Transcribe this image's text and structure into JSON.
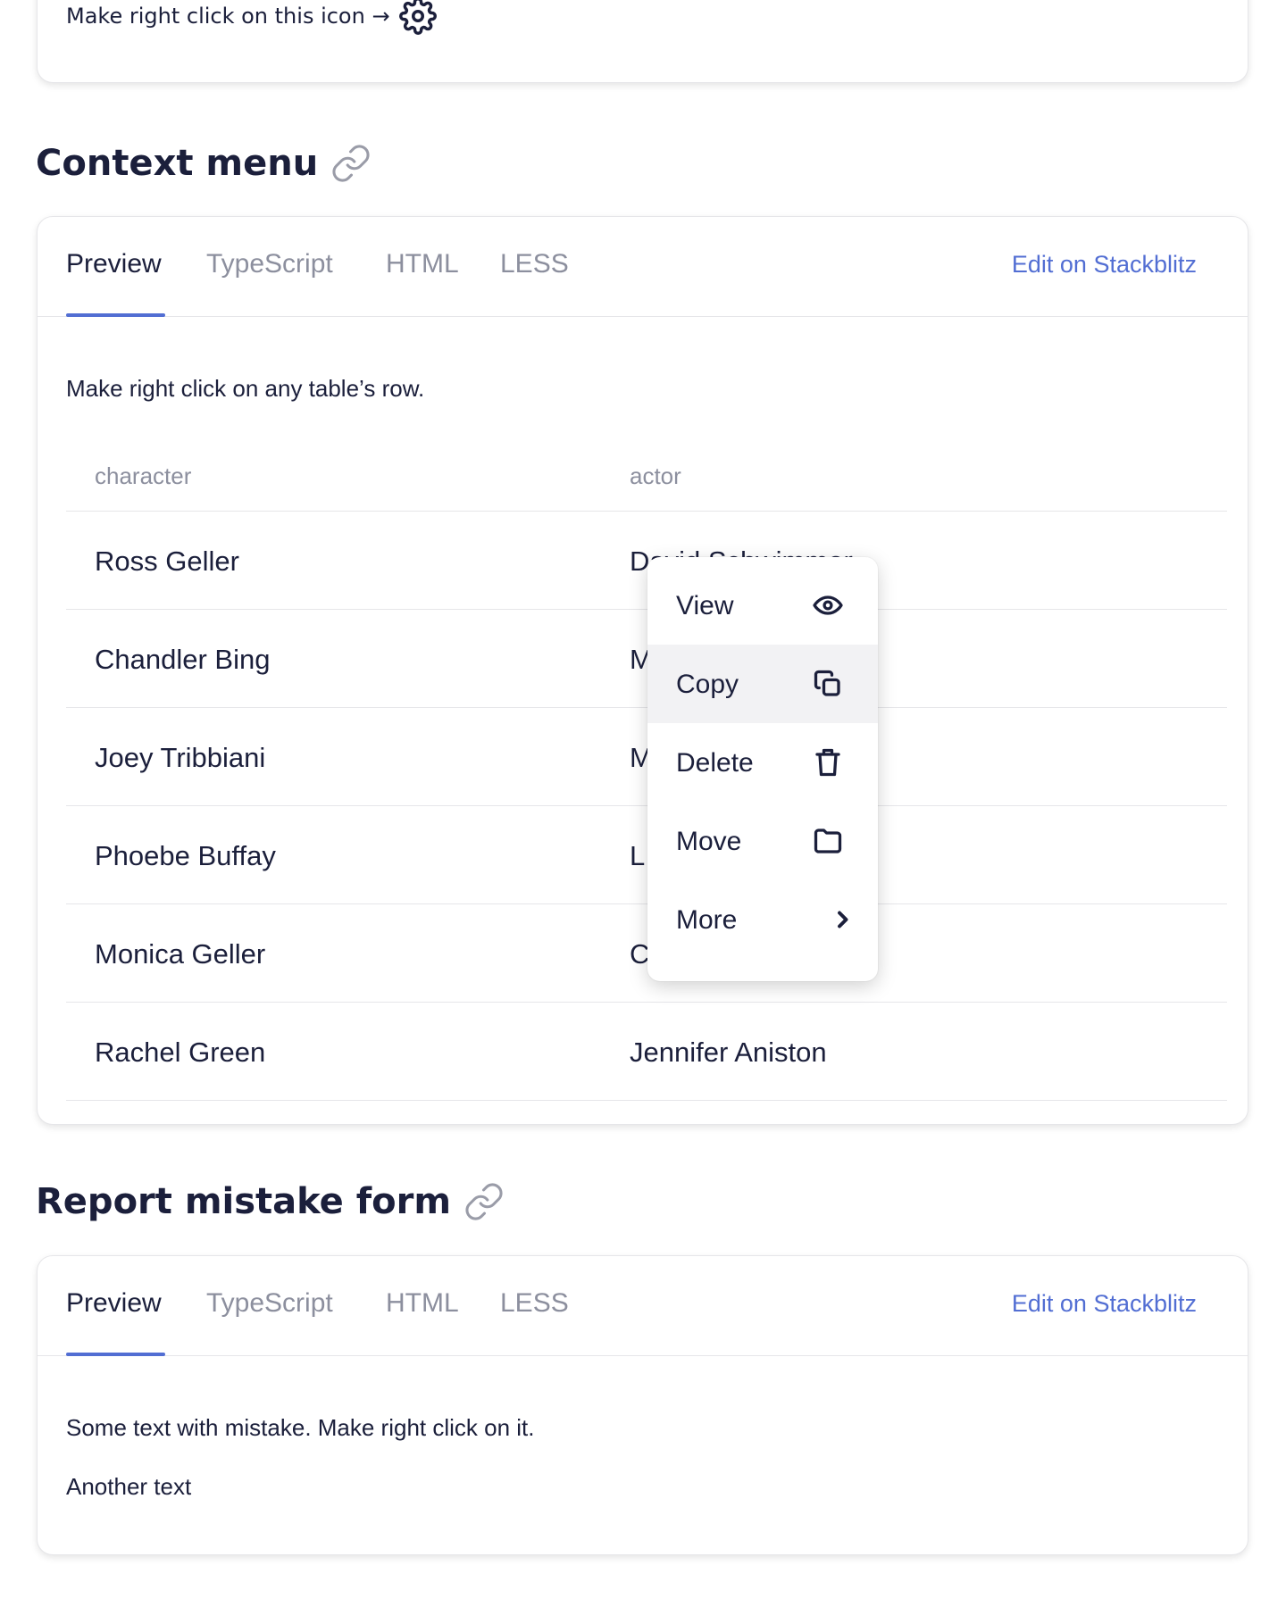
{
  "top_card": {
    "hint_text": "Make right click on this icon →",
    "icon": "gear-icon"
  },
  "context_section": {
    "title": "Context menu",
    "tabs": [
      "Preview",
      "TypeScript",
      "HTML",
      "LESS"
    ],
    "active_tab": "Preview",
    "edit_link": "Edit on Stackblitz",
    "description": "Make right click on any table’s row.",
    "table": {
      "columns": [
        "character",
        "actor"
      ],
      "rows": [
        [
          "Ross Geller",
          "David Schwimmer"
        ],
        [
          "Chandler Bing",
          "M"
        ],
        [
          "Joey Tribbiani",
          "M"
        ],
        [
          "Phoebe Buffay",
          "L"
        ],
        [
          "Monica Geller",
          "C"
        ],
        [
          "Rachel Green",
          "Jennifer Aniston"
        ]
      ]
    },
    "context_menu": {
      "items": [
        {
          "label": "View",
          "icon": "eye-icon"
        },
        {
          "label": "Copy",
          "icon": "copy-icon"
        },
        {
          "label": "Delete",
          "icon": "trash-icon"
        },
        {
          "label": "Move",
          "icon": "folder-icon"
        },
        {
          "label": "More",
          "icon": "chevron-right-icon"
        }
      ],
      "hovered_item": "Copy"
    }
  },
  "report_section": {
    "title": "Report mistake form",
    "tabs": [
      "Preview",
      "TypeScript",
      "HTML",
      "LESS"
    ],
    "active_tab": "Preview",
    "edit_link": "Edit on Stackblitz",
    "text_1": "Some text with mistake. Make right click on it.",
    "text_2": "Another text"
  },
  "colors": {
    "accent": "#526ed3",
    "text": "#1b1f3b",
    "muted": "#8c8f9e",
    "border": "#e6e6e9"
  }
}
